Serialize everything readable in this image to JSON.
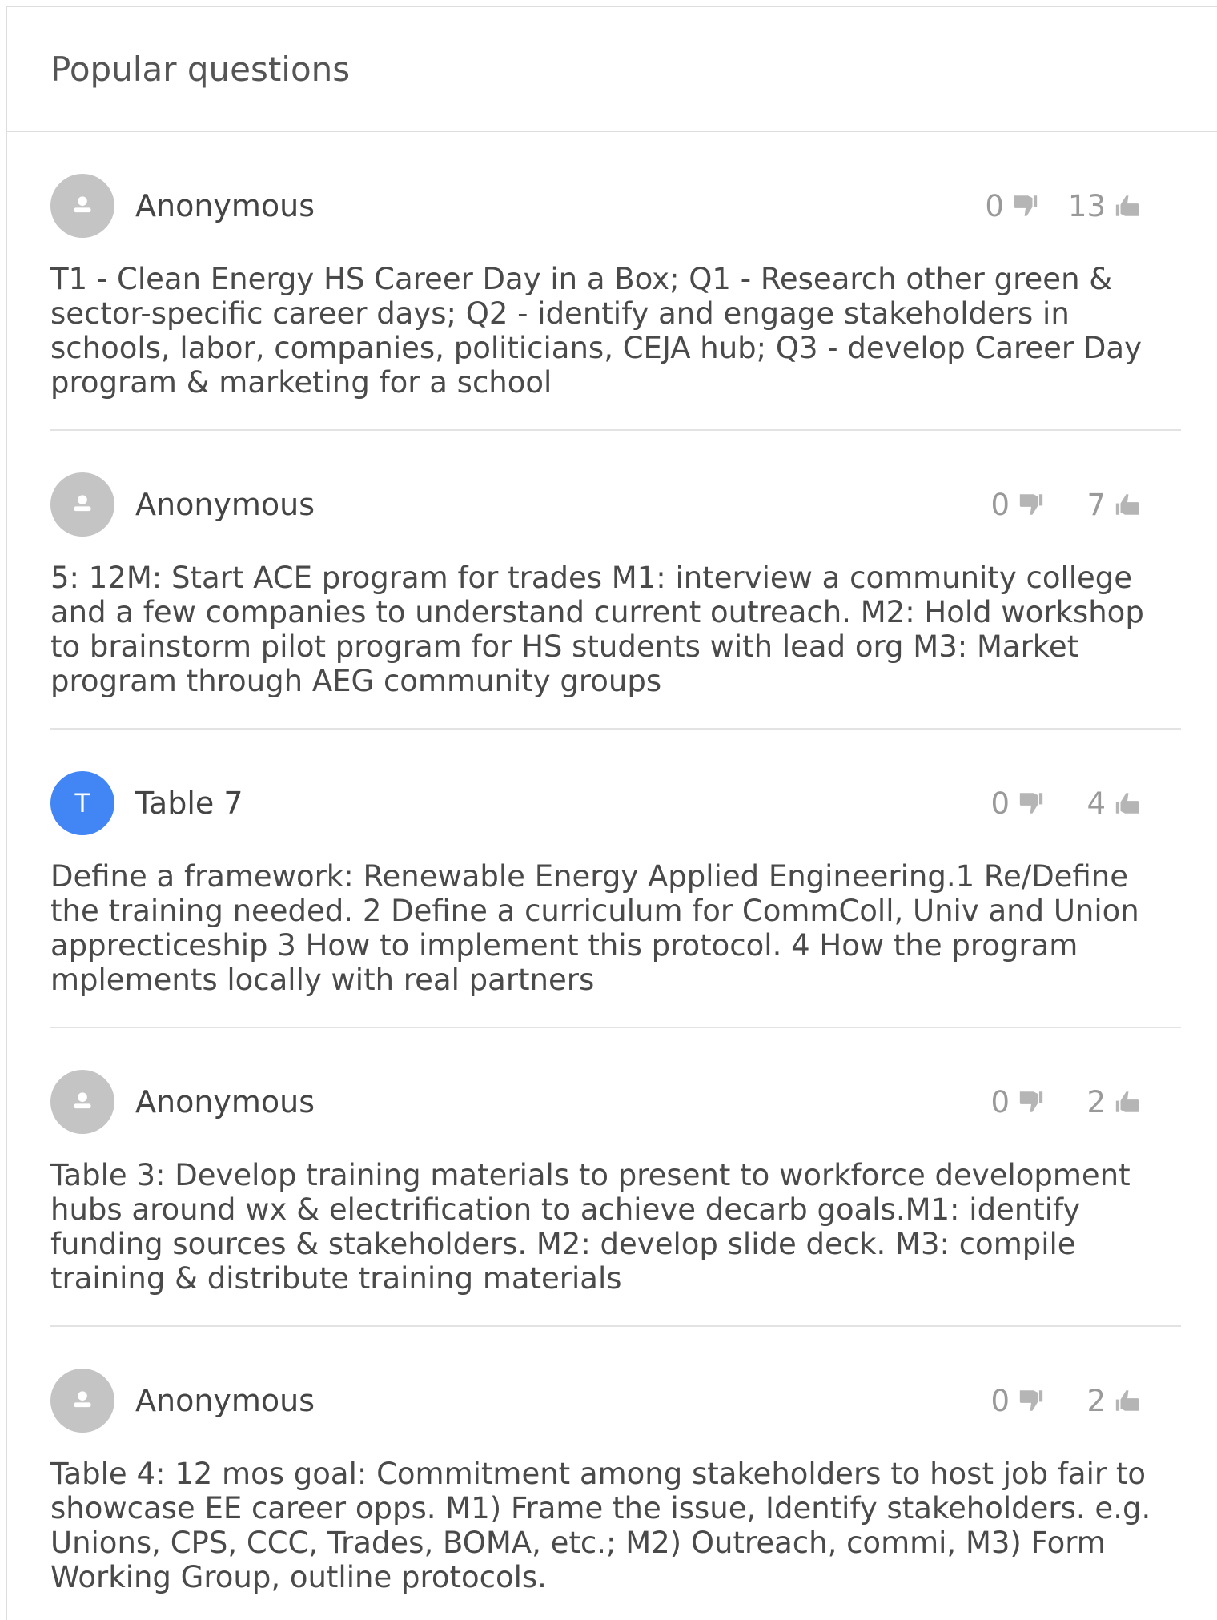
{
  "header": {
    "title": "Popular questions"
  },
  "questions": [
    {
      "author": "Anonymous",
      "avatar_letter": "",
      "avatar_type": "anonymous",
      "downvotes": "0",
      "upvotes": "13",
      "text": "T1 - Clean Energy HS Career Day in a Box; Q1 - Research other green & sector-specific career days; Q2 - identify and engage stakeholders in schools, labor, companies, politicians, CEJA hub; Q3 - develop Career Day program & marketing for a school"
    },
    {
      "author": "Anonymous",
      "avatar_letter": "",
      "avatar_type": "anonymous",
      "downvotes": "0",
      "upvotes": "7",
      "text": "5: 12M: Start ACE program for trades M1: interview a community college and a few companies to understand current outreach. M2: Hold workshop to brainstorm pilot program for HS students with lead org M3: Market program through AEG community groups"
    },
    {
      "author": "Table 7",
      "avatar_letter": "T",
      "avatar_type": "letter",
      "downvotes": "0",
      "upvotes": "4",
      "text": "Define a framework: Renewable Energy Applied Engineering.1 Re/Define the training needed. 2 Define a curriculum for CommColl, Univ and Union apprecticeship 3 How to implement this protocol. 4 How the program mplements locally with real partners"
    },
    {
      "author": "Anonymous",
      "avatar_letter": "",
      "avatar_type": "anonymous",
      "downvotes": "0",
      "upvotes": "2",
      "text": "Table 3: Develop training materials to present to workforce development hubs around wx & electrification to achieve decarb goals.M1: identify funding sources & stakeholders. M2: develop slide deck. M3: compile training & distribute training materials"
    },
    {
      "author": "Anonymous",
      "avatar_letter": "",
      "avatar_type": "anonymous",
      "downvotes": "0",
      "upvotes": "2",
      "text": "Table 4: 12 mos goal: Commitment among stakeholders to host job fair to showcase EE career opps. M1) Frame the issue, Identify stakeholders. e.g. Unions, CPS, CCC, Trades, BOMA, etc.; M2) Outreach, commi, M3) Form Working Group, outline protocols."
    }
  ],
  "colors": {
    "anonymous_avatar": "#c4c4c4",
    "letter_avatar": "#4285f4",
    "vote_gray": "#9a9a9a"
  },
  "icons": {
    "anonymous_avatar": "person-icon",
    "downvote": "thumbs-down-icon",
    "upvote": "thumbs-up-icon"
  }
}
